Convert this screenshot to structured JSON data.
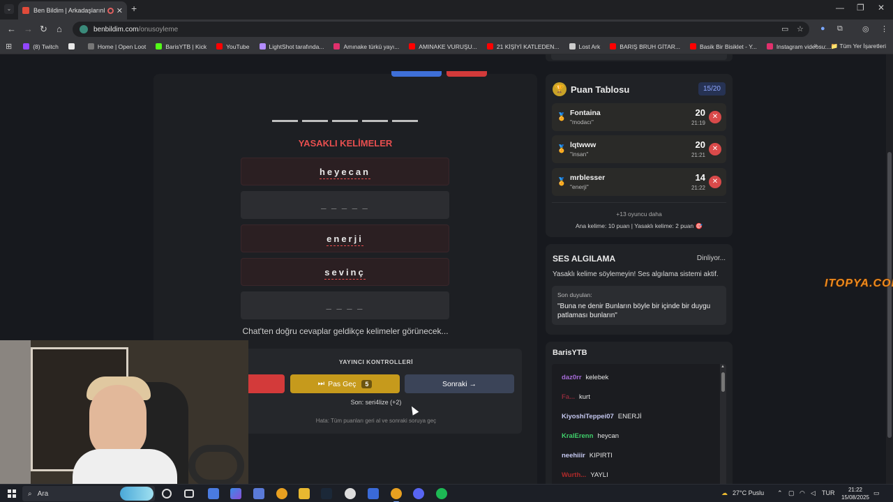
{
  "browser": {
    "tab_title": "Ben Bildim | Arkadaşlarınla",
    "url_host": "benbildim.com",
    "url_path": "/onusoyleme",
    "bookmarks": [
      {
        "label": "(8) Twitch",
        "color": "#9146ff"
      },
      {
        "label": "",
        "color": "#e8e8e8"
      },
      {
        "label": "Home | Open Loot",
        "color": "#777777"
      },
      {
        "label": "BarisYTB | Kick",
        "color": "#53fc18"
      },
      {
        "label": "YouTube",
        "color": "#ff0000"
      },
      {
        "label": "LightShot tarafında...",
        "color": "#b38cff"
      },
      {
        "label": "Amınake türkü yayı...",
        "color": "#e1306c"
      },
      {
        "label": "AMINAKE VURUŞU...",
        "color": "#ff0000"
      },
      {
        "label": "21 KİŞİYİ KATLEDEN...",
        "color": "#ff0000"
      },
      {
        "label": "Lost Ark",
        "color": "#cccccc"
      },
      {
        "label": "BARIŞ BRUH GİTAR...",
        "color": "#ff0000"
      },
      {
        "label": "Basik Bir Bisiklet - Y...",
        "color": "#ff0000"
      },
      {
        "label": "Instagram videosu:...",
        "color": "#e1306c"
      }
    ],
    "all_bookmarks": "Tüm Yer İşaretleri"
  },
  "game": {
    "banned_title": "YASAKLI KELİMELER",
    "banned_words": [
      {
        "text": "heyecan",
        "revealed": true
      },
      {
        "text": "_ _ _ _ _",
        "revealed": false
      },
      {
        "text": "enerji",
        "revealed": true
      },
      {
        "text": "sevinç",
        "revealed": true
      },
      {
        "text": "_ _ _ _",
        "revealed": false
      }
    ],
    "hint": "Chat'ten doğru cevaplar geldikçe kelimeler görünecek...",
    "controls": {
      "title": "YAYINCI KONTROLLERİ",
      "skip_label": "Pas Geç",
      "skip_count": "5",
      "next_label": "Sonraki →",
      "last": "Son: seri4lize (+2)",
      "error": "Hata: Tüm puanları geri al ve sonraki soruya geç"
    }
  },
  "scoreboard": {
    "title": "Puan Tablosu",
    "count": "15/20",
    "players": [
      {
        "name": "Fontaina",
        "word": "\"modacı\"",
        "points": "20",
        "time": "21:19",
        "medal_color": "#d8a21c"
      },
      {
        "name": "lqtwww",
        "word": "\"insan\"",
        "points": "20",
        "time": "21:21",
        "medal_color": "#9fb6d0"
      },
      {
        "name": "mrblesser",
        "word": "\"enerji\"",
        "points": "14",
        "time": "21:22",
        "medal_color": "#4fb85a"
      }
    ],
    "more": "+13 oyuncu daha",
    "rules": "Ana kelime: 10 puan | Yasaklı kelime: 2 puan 🎯"
  },
  "voice": {
    "title": "SES ALGILAMA",
    "status": "Dinliyor...",
    "warning": "Yasaklı kelime söylemeyin! Ses algılama sistemi aktif.",
    "last_label": "Son duyulan:",
    "last_text": "\"Buna ne denir Bunların böyle bir içinde bir duygu patlaması bunların\""
  },
  "chat": {
    "title": "BarisYTB",
    "messages": [
      {
        "user": "daz0rr",
        "text": "kelebek",
        "color": "#a66bd8"
      },
      {
        "user": "Fa...",
        "text": "kurt",
        "color": "#8a2a3a"
      },
      {
        "user": "KiyoshiTeppei07",
        "text": "ENERJİ",
        "color": "#c5c8f0"
      },
      {
        "user": "KralErenn",
        "text": "heycan",
        "color": "#3fcf6a"
      },
      {
        "user": "neehiiir",
        "text": "KIPIRTI",
        "color": "#c5c8f0"
      },
      {
        "user": "Wurth...",
        "text": "YAYLI",
        "color": "#b02a2a"
      }
    ]
  },
  "watermark": "ITOPYA.COM",
  "taskbar": {
    "search_placeholder": "Ara",
    "weather": "27°C  Puslu",
    "lang": "TUR",
    "time": "21:22",
    "date": "15/08/2025"
  }
}
